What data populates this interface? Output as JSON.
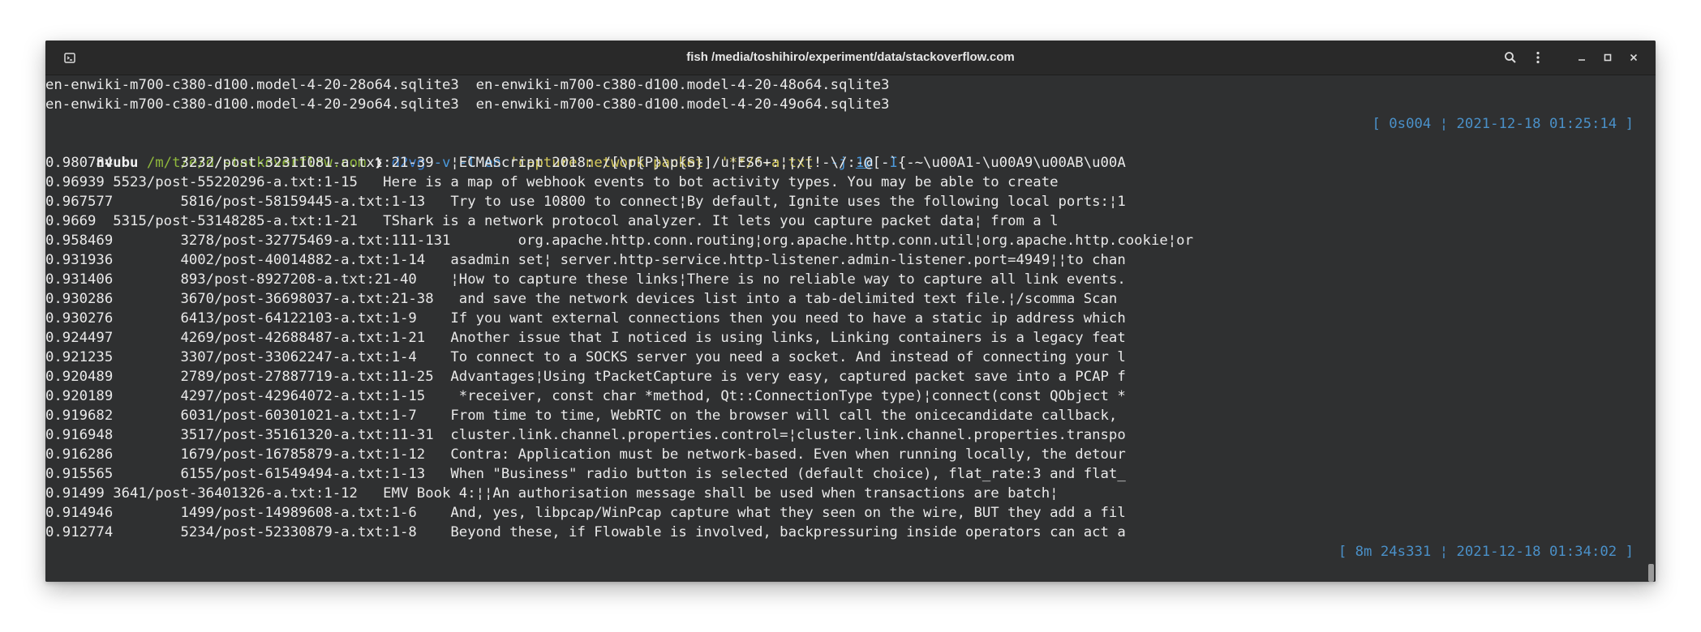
{
  "window": {
    "title": "fish /media/toshihiro/experiment/data/stackoverflow.com"
  },
  "icons": {
    "terminal": "terminal-icon",
    "search": "search-icon",
    "menu": "kebab-menu-icon",
    "minimize": "minimize-icon",
    "maximize": "maximize-icon",
    "close": "close-icon"
  },
  "colors": {
    "background": "#2f3031",
    "titlebar": "#292929",
    "text": "#e9e9e9",
    "status": "#4a90c8",
    "path": "#8fb83c",
    "command": "#3b82d6",
    "string": "#d4c85c"
  },
  "terminal": {
    "ls_lines": [
      "en-enwiki-m700-c380-d100.model-4-20-28o64.sqlite3  en-enwiki-m700-c380-d100.model-4-20-48o64.sqlite3",
      "en-enwiki-m700-c380-d100.model-4-20-29o64.sqlite3  en-enwiki-m700-c380-d100.model-4-20-49o64.sqlite3"
    ],
    "status1": "[ 0s004 ¦ 2021-12-18 01:25:14 ]",
    "prompt": {
      "host": "nvubu",
      "path": "/m/t/e/d/stackoverflow.com",
      "arrow": "❯"
    },
    "command": {
      "name": "d2vg",
      "opts": " -v -l en ",
      "arg1": "'capture network packet'",
      "space": " ",
      "arg2": "'**/*-a.txt'",
      "opt_j": " -j ",
      "jobs": "10",
      "opt_i": " -I"
    },
    "results": [
      "0.980784        3232/post-32311081-a.txt:21-39  ¦ECMAScript 2018: /[\\p{P}\\p{S}]/u¦ES6+:¦¦/[!-\\/:-@[-`{-~\\u00A1-\\u00A9\\u00AB\\u00A",
      "0.96939 5523/post-55220296-a.txt:1-15   Here is a map of webhook events to bot activity types. You may be able to create",
      "0.967577        5816/post-58159445-a.txt:1-13   Try to use 10800 to connect¦By default, Ignite uses the following local ports:¦1",
      "0.9669  5315/post-53148285-a.txt:1-21   TShark is a network protocol analyzer. It lets you capture packet data¦ from a l",
      "0.958469        3278/post-32775469-a.txt:111-131        org.apache.http.conn.routing¦org.apache.http.conn.util¦org.apache.http.cookie¦or",
      "0.931936        4002/post-40014882-a.txt:1-14   asadmin set¦ server.http-service.http-listener.admin-listener.port=4949¦¦to chan",
      "0.931406        893/post-8927208-a.txt:21-40    ¦How to capture these links¦There is no reliable way to capture all link events.",
      "0.930286        3670/post-36698037-a.txt:21-38   and save the network devices list into a tab-delimited text file.¦/scomma Scan",
      "0.930276        6413/post-64122103-a.txt:1-9    If you want external connections then you need to have a static ip address which",
      "0.924497        4269/post-42688487-a.txt:1-21   Another issue that I noticed is using links, Linking containers is a legacy feat",
      "0.921235        3307/post-33062247-a.txt:1-4    To connect to a SOCKS server you need a socket. And instead of connecting your l",
      "0.920489        2789/post-27887719-a.txt:11-25  Advantages¦Using tPacketCapture is very easy, captured packet save into a PCAP f",
      "0.920189        4297/post-42964072-a.txt:1-15    *receiver, const char *method, Qt::ConnectionType type)¦connect(const QObject *",
      "0.919682        6031/post-60301021-a.txt:1-7    From time to time, WebRTC on the browser will call the onicecandidate callback,",
      "0.916948        3517/post-35161320-a.txt:11-31  cluster.link.channel.properties.control=¦cluster.link.channel.properties.transpo",
      "0.916286        1679/post-16785879-a.txt:1-12   Contra: Application must be network-based. Even when running locally, the detour",
      "0.915565        6155/post-61549494-a.txt:1-13   When \"Business\" radio button is selected (default choice), flat_rate:3 and flat_",
      "0.91499 3641/post-36401326-a.txt:1-12   EMV Book 4:¦¦An authorisation message shall be used when transactions are batch¦",
      "0.914946        1499/post-14989608-a.txt:1-6    And, yes, libpcap/WinPcap capture what they seen on the wire, BUT they add a fil",
      "0.912774        5234/post-52330879-a.txt:1-8    Beyond these, if Flowable is involved, backpressuring inside operators can act a"
    ],
    "status2": "[ 8m 24s331 ¦ 2021-12-18 01:34:02 ]"
  }
}
